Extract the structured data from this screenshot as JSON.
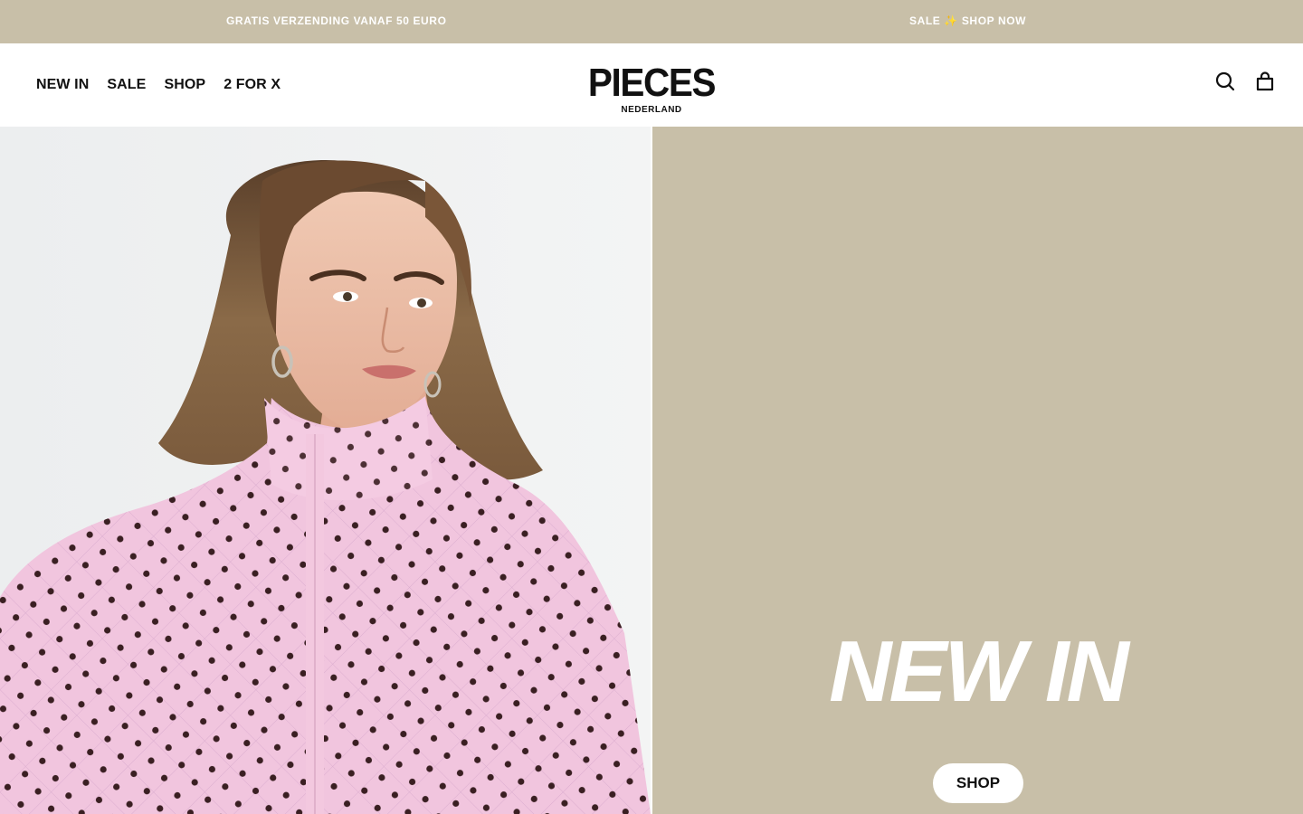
{
  "announcement": {
    "left_text": "GRATIS VERZENDING VANAF 50 EURO",
    "right_prefix": "SALE",
    "right_sparkle": "✨",
    "right_suffix": "SHOP NOW",
    "background": "#c8bfa8"
  },
  "header": {
    "nav": [
      "NEW IN",
      "SALE",
      "SHOP",
      "2 FOR X"
    ],
    "logo": "PIECES",
    "logo_sub": "NEDERLAND",
    "icons": [
      "search-icon",
      "bag-icon"
    ]
  },
  "hero": {
    "title": "NEW IN",
    "cta": "SHOP",
    "panel_color": "#c8bfa8",
    "image_alt": "Model wearing pink quilted jacket with brown polka dots"
  }
}
